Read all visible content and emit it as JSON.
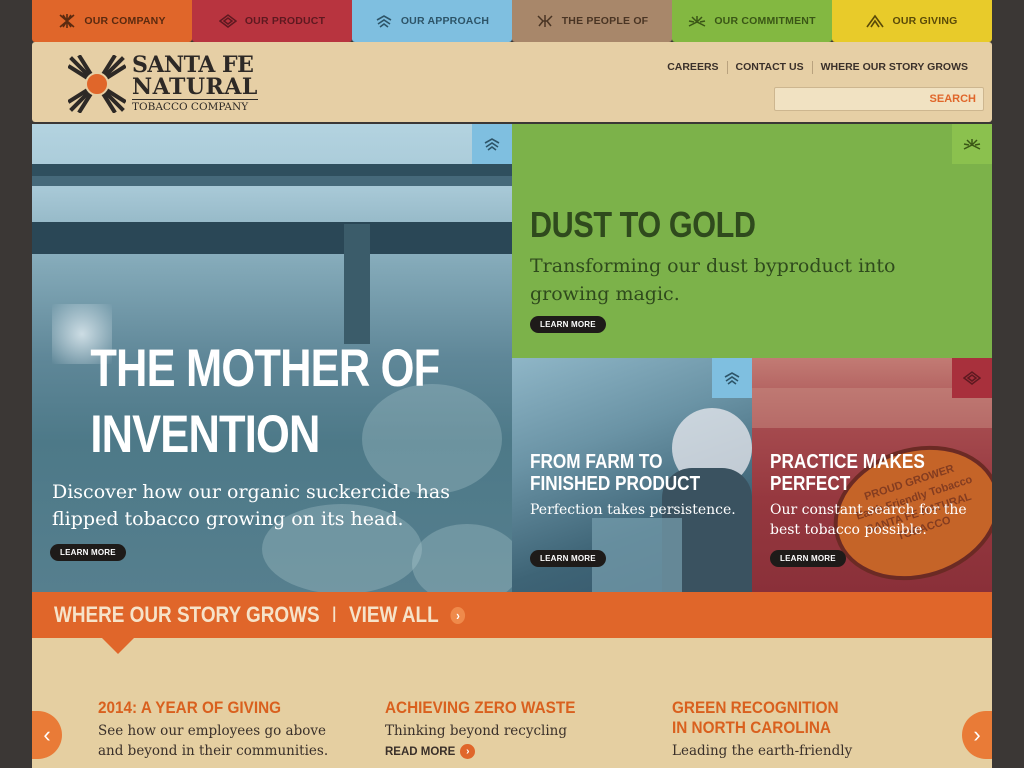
{
  "nav": {
    "tabs": [
      {
        "label": "OUR COMPANY",
        "icon": "company-icon"
      },
      {
        "label": "OUR PRODUCT",
        "icon": "product-icon"
      },
      {
        "label": "OUR APPROACH",
        "icon": "approach-icon"
      },
      {
        "label": "THE PEOPLE OF",
        "icon": "people-icon"
      },
      {
        "label": "OUR COMMITMENT",
        "icon": "commitment-icon"
      },
      {
        "label": "OUR GIVING",
        "icon": "giving-icon"
      }
    ]
  },
  "header": {
    "logo": {
      "line1": "SANTA FE",
      "line2": "NATURAL",
      "line3": "TOBACCO COMPANY"
    },
    "links": [
      "CAREERS",
      "CONTACT US",
      "WHERE OUR STORY GROWS"
    ],
    "search": {
      "value": "",
      "placeholder": "",
      "button": "SEARCH"
    }
  },
  "panels": {
    "hero": {
      "title_line1": "THE MOTHER OF",
      "title_line2": "INVENTION",
      "description": "Discover how our organic suckercide has flipped tobacco growing on its head.",
      "button": "LEARN MORE",
      "icon": "approach-icon"
    },
    "dust": {
      "title": "DUST TO GOLD",
      "description": "Transforming our dust byproduct into growing magic.",
      "button": "LEARN MORE",
      "icon": "commitment-icon"
    },
    "farm": {
      "title": "FROM FARM TO FINISHED PRODUCT",
      "description": "Perfection takes persistence.",
      "button": "LEARN MORE",
      "icon": "approach-icon"
    },
    "practice": {
      "title": "PRACTICE MAKES PERFECT",
      "description": "Our constant search for the best tobacco possible.",
      "button": "LEARN MORE",
      "icon": "product-icon",
      "sign_text": [
        "PROUD GROWER",
        "Earth Friendly Tobacco",
        "SANTA FE NATURAL TOBACCO"
      ]
    }
  },
  "story": {
    "title": "WHERE OUR STORY GROWS",
    "separator": "I",
    "view_all": "VIEW ALL"
  },
  "cards": [
    {
      "title": "2014: A YEAR OF GIVING",
      "description": "See how our employees go above and beyond in their communities.",
      "link": ""
    },
    {
      "title": "ACHIEVING ZERO WASTE",
      "description": "Thinking beyond recycling",
      "link": "READ MORE"
    },
    {
      "title": "GREEN RECOGNITION IN NORTH CAROLINA",
      "description": "Leading the earth-friendly",
      "link": ""
    }
  ],
  "carousel": {
    "prev": "‹",
    "next": "›"
  },
  "colors": {
    "orange": "#e0662a",
    "red": "#b8343f",
    "blue": "#7fbfe0",
    "brown": "#a8876a",
    "green": "#83b841",
    "yellow": "#e8cb2a",
    "tan": "#e5cfa1"
  }
}
